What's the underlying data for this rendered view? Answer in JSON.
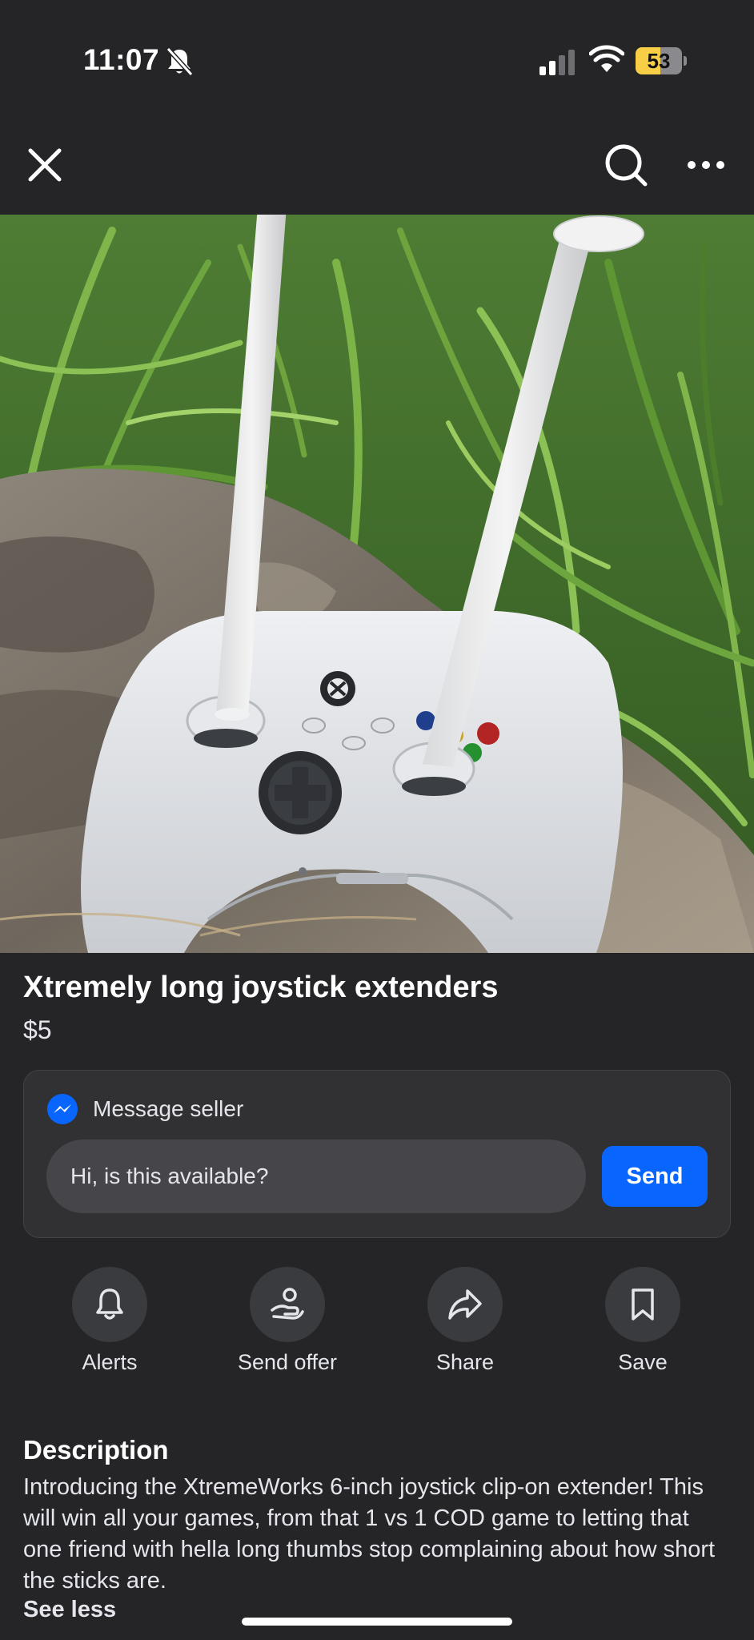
{
  "status_bar": {
    "time": "11:07",
    "battery_percent": "53",
    "battery_level": 0.53,
    "icons": [
      "bell-slash-icon",
      "cellular-signal-icon",
      "wifi-icon",
      "battery-icon"
    ]
  },
  "nav": {
    "icons": [
      "close-icon",
      "search-icon",
      "more-options-icon"
    ]
  },
  "listing": {
    "title": "Xtremely long joystick extenders",
    "price": "$5"
  },
  "message": {
    "heading": "Message seller",
    "input_value": "Hi, is this available?",
    "send_label": "Send",
    "accent_color": "#0866ff"
  },
  "actions": [
    {
      "label": "Alerts",
      "icon": "bell-icon"
    },
    {
      "label": "Send offer",
      "icon": "offer-icon"
    },
    {
      "label": "Share",
      "icon": "share-arrow-icon"
    },
    {
      "label": "Save",
      "icon": "bookmark-icon"
    }
  ],
  "description": {
    "heading": "Description",
    "text": "Introducing the XtremeWorks 6-inch joystick clip-on extender! This will win all your games, from that 1 vs 1 COD game to letting that one friend with hella long thumbs stop complaining about how short the sticks are.",
    "toggle_label": "See less"
  }
}
